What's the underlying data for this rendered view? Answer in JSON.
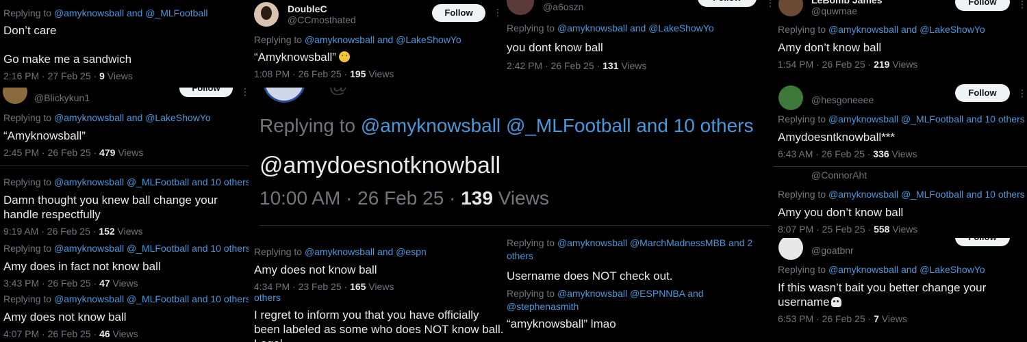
{
  "rep": {
    "prefix": "Replying to",
    "and": "and",
    "amy": "@amyknowsball",
    "mlf": "@_MLFootball",
    "lake": "@LakeShowYo",
    "espn": "@espn",
    "ten_others": "and 10 others",
    "espnnba": "@ESPNNBA",
    "stephen": "@stephenasmith",
    "march": "@MarchMadnessMBB",
    "and_2": "and 2",
    "others": "others"
  },
  "views_word": "Views",
  "follow_label": "Follow",
  "col1": {
    "t1": {
      "text1": "Don’t care",
      "text2": "Go make me a sandwich",
      "time": "2:16 PM · 27 Feb 25 · ",
      "views": "9"
    },
    "t2": {
      "handle": "@Blickykun1",
      "text": "“Amyknowsball”",
      "time": "2:45 PM · 26 Feb 25 · ",
      "views": "479"
    },
    "t3": {
      "text": "Damn thought you knew ball change your handle respectfully",
      "time": "9:19 AM · 26 Feb 25 · ",
      "views": "152"
    },
    "t4": {
      "text": "Amy does in fact not know ball",
      "time": "3:43 PM · 26 Feb 25 · ",
      "views": "47"
    },
    "t5": {
      "text": "Amy does not know ball",
      "time": "4:07 PM · 26 Feb 25 · ",
      "views": "46"
    }
  },
  "col2": {
    "t1": {
      "name": "DoubleC",
      "handle": "@CCmosthated",
      "text": "“Amyknowsball”",
      "time": "1:08 PM · 26 Feb 25 · ",
      "views": "195"
    },
    "big": {
      "others": "and 10 others",
      "text": "@amydoesnotknowball",
      "time": "10:00 AM · 26 Feb 25 · ",
      "views": "139"
    },
    "t3": {
      "text": "Amy does not know ball",
      "time": "4:34 PM · 23 Feb 25 · ",
      "views": "165"
    },
    "t4": {
      "text": "I regret to inform you that you have officially been labeled as some who does NOT know ball. Legal"
    }
  },
  "col3": {
    "t1": {
      "handle": "@a6oszn",
      "text": "you dont know ball",
      "time": "2:42 PM · 26 Feb 25 · ",
      "views": "131"
    },
    "t2": {
      "text": "Username does NOT check out."
    },
    "t3": {
      "text": "“amyknowsball” lmao"
    }
  },
  "col4": {
    "t1": {
      "name": "LeBomb James",
      "handle": "@quwmae",
      "text": "Amy don’t know ball",
      "time": "1:54 PM · 26 Feb 25 · ",
      "views": "219"
    },
    "t2": {
      "handle": "@hesgoneeee",
      "text": "Amydoesntknowball***",
      "time": "6:43 AM · 26 Feb 25 · ",
      "views": "336"
    },
    "t3": {
      "handle": "@ConnorAht",
      "text": "Amy you don’t know ball",
      "time": "8:07 PM · 25 Feb 25 · ",
      "views": "558"
    },
    "t4": {
      "handle": "@goatbnr",
      "text": "If this wasn’t bait you better change your username",
      "time": "6:53 PM · 26 Feb 25 · ",
      "views": "7"
    }
  }
}
